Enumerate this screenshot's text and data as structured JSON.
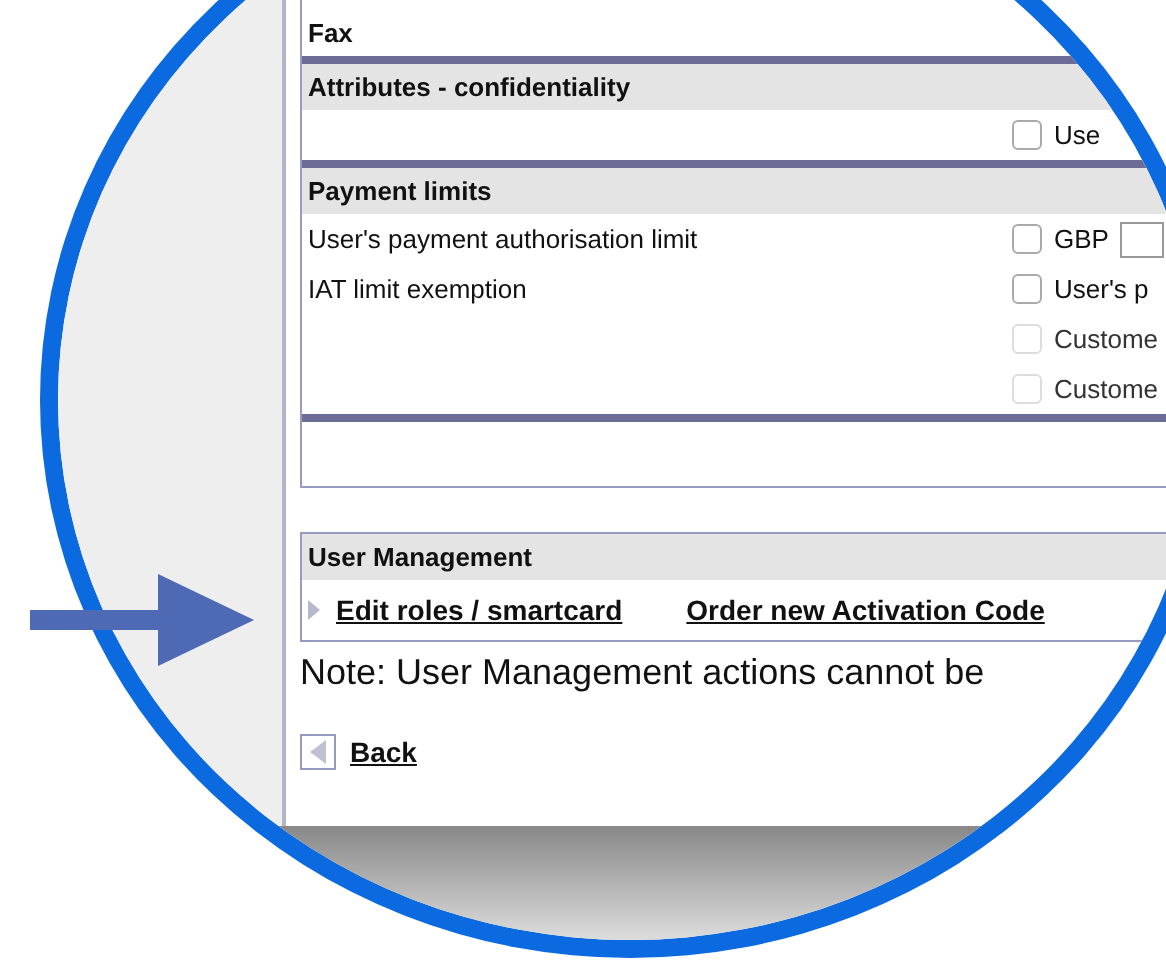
{
  "fax_label": "Fax",
  "sections": [
    {
      "title": "Attributes - confidentiality",
      "rows": [
        {
          "option": {
            "text": "Use",
            "checked": false,
            "disabled": false
          }
        }
      ]
    },
    {
      "title": "Payment limits",
      "rows": [
        {
          "label": "User's payment authorisation limit",
          "option": {
            "text": "GBP",
            "checked": false,
            "disabled": false,
            "field": true
          }
        },
        {
          "label": "IAT limit exemption",
          "option": {
            "text": "User's p",
            "checked": false,
            "disabled": false
          }
        },
        {
          "option": {
            "text": "Custome",
            "checked": false,
            "disabled": true
          }
        },
        {
          "option": {
            "text": "Custome",
            "checked": false,
            "disabled": true
          }
        }
      ]
    }
  ],
  "user_management": {
    "title": "User Management",
    "links": [
      "Edit roles / smartcard",
      "Order new Activation Code"
    ]
  },
  "note": "Note: User Management actions cannot be",
  "back": "Back"
}
